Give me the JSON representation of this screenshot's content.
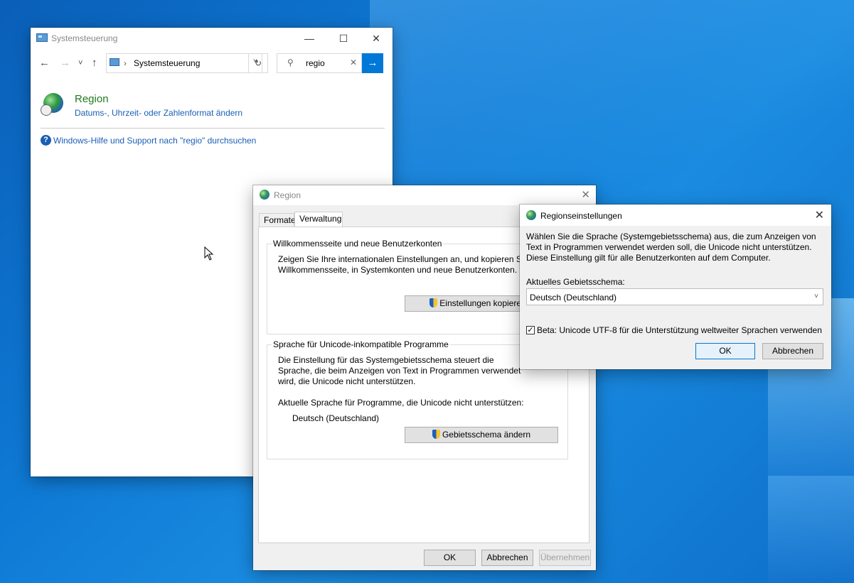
{
  "control_panel": {
    "title": "Systemsteuerung",
    "minimize_glyph": "—",
    "maximize_glyph": "☐",
    "close_glyph": "✕",
    "back_glyph": "←",
    "forward_glyph": "→",
    "recent_glyph": "˅",
    "up_glyph": "↑",
    "address_separator": "›",
    "address_dropdown_glyph": "˅",
    "refresh_glyph": "↻",
    "search_glyph": "⚲",
    "clear_glyph": "✕",
    "go_glyph": "→",
    "breadcrumb": "Systemsteuerung",
    "search_value": "regio",
    "result": {
      "title": "Region",
      "subtitle": "Datums-, Uhrzeit- oder Zahlenformat ändern"
    },
    "help_glyph": "?",
    "help_link": "Windows-Hilfe und Support nach \"regio\" durchsuchen"
  },
  "region": {
    "title": "Region",
    "close_glyph": "✕",
    "tabs": [
      {
        "label": "Formate"
      },
      {
        "label": "Verwaltung"
      }
    ],
    "welcome_group": {
      "title": "Willkommensseite und neue Benutzerkonten",
      "text": "Zeigen Sie Ihre internationalen Einstellungen an, und kopieren Sie die Willkommensseite, in Systemkonten und neue Benutzerkonten.",
      "button": "Einstellungen kopieren..."
    },
    "unicode_group": {
      "title": "Sprache für Unicode-inkompatible Programme",
      "text": "Die Einstellung für das Systemgebietsschema steuert die Sprache, die beim Anzeigen von Text in Programmen verwendet wird, die Unicode nicht unterstützen.",
      "current_label": "Aktuelle Sprache für Programme, die Unicode nicht unterstützen:",
      "current_value": "Deutsch (Deutschland)",
      "button": "Gebietsschema ändern"
    },
    "ok": "OK",
    "cancel": "Abbrechen",
    "apply": "Übernehmen"
  },
  "region_settings": {
    "title": "Regionseinstellungen",
    "close_glyph": "✕",
    "description": "Wählen Sie die Sprache (Systemgebietsschema) aus, die zum Anzeigen von Text in Programmen verwendet werden soll, die Unicode nicht unterstützen. Diese Einstellung gilt für alle Benutzerkonten auf dem Computer.",
    "locale_label": "Aktuelles Gebietsschema:",
    "locale_value": "Deutsch (Deutschland)",
    "dropdown_glyph": "˅",
    "check_glyph": "✓",
    "utf8_checkbox": "Beta: Unicode UTF-8 für die Unterstützung weltweiter Sprachen verwenden",
    "utf8_checked": true,
    "ok": "OK",
    "cancel": "Abbrechen"
  }
}
